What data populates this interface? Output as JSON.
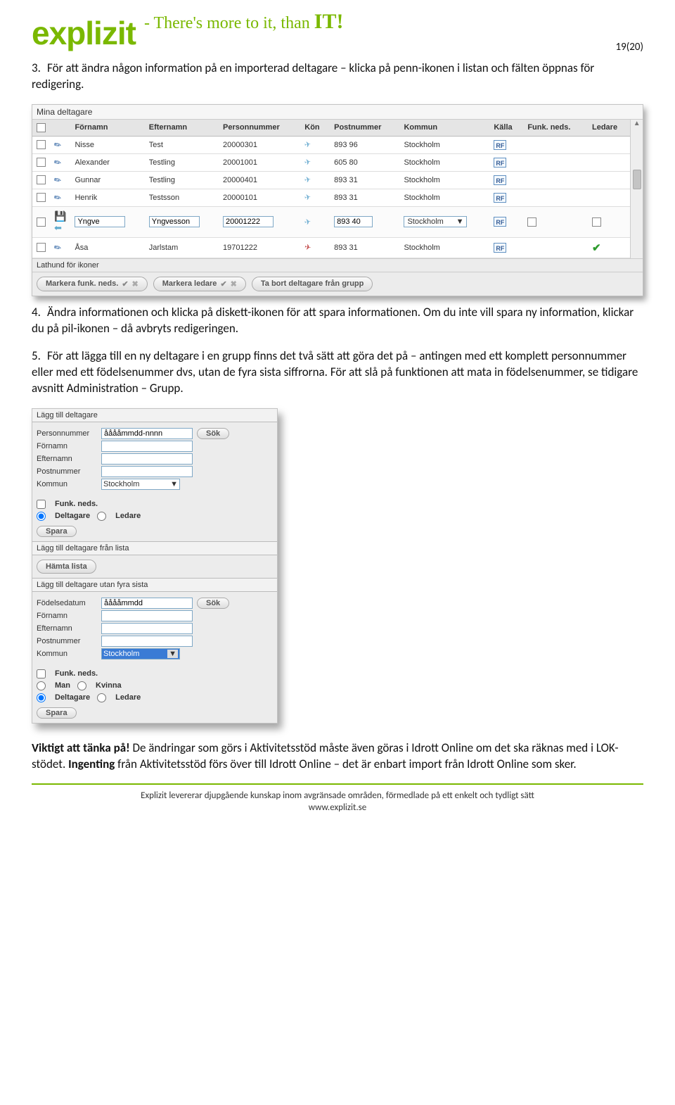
{
  "logo_text": "explizit",
  "tagline_lead": "- There's more to it, than ",
  "tagline_it": "IT!",
  "page_number": "19(20)",
  "instr3": {
    "num": "3.",
    "text": "För att ändra någon information på en importerad deltagare – klicka på penn-ikonen i listan och fälten öppnas för redigering."
  },
  "instr4": {
    "num": "4.",
    "text": "Ändra informationen och klicka på diskett-ikonen för att spara informationen. Om du inte vill spara ny information, klickar du på pil-ikonen – då avbryts redigeringen."
  },
  "instr5": {
    "num": "5.",
    "text": "För att lägga till en ny deltagare i en grupp finns det två sätt att göra det på – antingen med ett komplett personnummer eller med ett födelsenummer dvs, utan de fyra sista siffrorna. För att slå på funktionen att mata in födelsenummer, se tidigare avsnitt Administration – Grupp."
  },
  "grid": {
    "title": "Mina deltagare",
    "lathund": "Lathund för ikoner",
    "headers": {
      "fornamn": "Förnamn",
      "efternamn": "Efternamn",
      "personnummer": "Personnummer",
      "kon": "Kön",
      "postnummer": "Postnummer",
      "kommun": "Kommun",
      "kalla": "Källa",
      "funkneds": "Funk. neds.",
      "ledare": "Ledare"
    },
    "rows": [
      {
        "fornamn": "Nisse",
        "efternamn": "Test",
        "pnr": "20000301",
        "kon": "m",
        "post": "893 96",
        "kommun": "Stockholm",
        "kalla": "RF"
      },
      {
        "fornamn": "Alexander",
        "efternamn": "Testling",
        "pnr": "20001001",
        "kon": "m",
        "post": "605 80",
        "kommun": "Stockholm",
        "kalla": "RF"
      },
      {
        "fornamn": "Gunnar",
        "efternamn": "Testling",
        "pnr": "20000401",
        "kon": "m",
        "post": "893 31",
        "kommun": "Stockholm",
        "kalla": "RF"
      },
      {
        "fornamn": "Henrik",
        "efternamn": "Testsson",
        "pnr": "20000101",
        "kon": "m",
        "post": "893 31",
        "kommun": "Stockholm",
        "kalla": "RF"
      },
      {
        "fornamn": "Yngve",
        "efternamn": "Yngvesson",
        "pnr": "20001222",
        "kon": "m",
        "post": "893 40",
        "kommun": "Stockholm",
        "kalla": "RF",
        "editing": true
      },
      {
        "fornamn": "Åsa",
        "efternamn": "Jarlstam",
        "pnr": "19701222",
        "kon": "f",
        "post": "893 31",
        "kommun": "Stockholm",
        "kalla": "RF",
        "ledare": true
      }
    ],
    "btn_markera_funk": "Markera funk. neds.",
    "btn_markera_ledare": "Markera ledare",
    "btn_tabort": "Ta bort deltagare från grupp"
  },
  "form": {
    "sec1_head": "Lägg till deltagare",
    "labels": {
      "personnummer": "Personnummer",
      "fornamn": "Förnamn",
      "efternamn": "Efternamn",
      "postnummer": "Postnummer",
      "kommun": "Kommun",
      "fodelse": "Födelsedatum"
    },
    "placeholder_pnr": "ååååmmdd-nnnn",
    "placeholder_fodelse": "ååååmmdd",
    "kommun_value": "Stockholm",
    "btn_sok": "Sök",
    "chk_funkneds": "Funk. neds.",
    "radio_deltagare": "Deltagare",
    "radio_ledare": "Ledare",
    "radio_man": "Man",
    "radio_kvinna": "Kvinna",
    "btn_spara": "Spara",
    "sec2_head": "Lägg till deltagare från lista",
    "btn_hamta": "Hämta lista",
    "sec3_head": "Lägg till deltagare utan fyra sista"
  },
  "note": {
    "lead": "Viktigt att tänka på! ",
    "p1": "De ändringar som görs i Aktivitetsstöd måste även göras i Idrott Online om det ska räknas med i LOK-stödet. ",
    "strong2": "Ingenting",
    "p2": " från Aktivitetsstöd förs över till Idrott Online – det är enbart import från Idrott Online som sker."
  },
  "footer_line1": "Explizit levererar djupgående kunskap inom avgränsade områden, förmedlade på ett enkelt och tydligt sätt",
  "footer_line2": "www.explizit.se"
}
